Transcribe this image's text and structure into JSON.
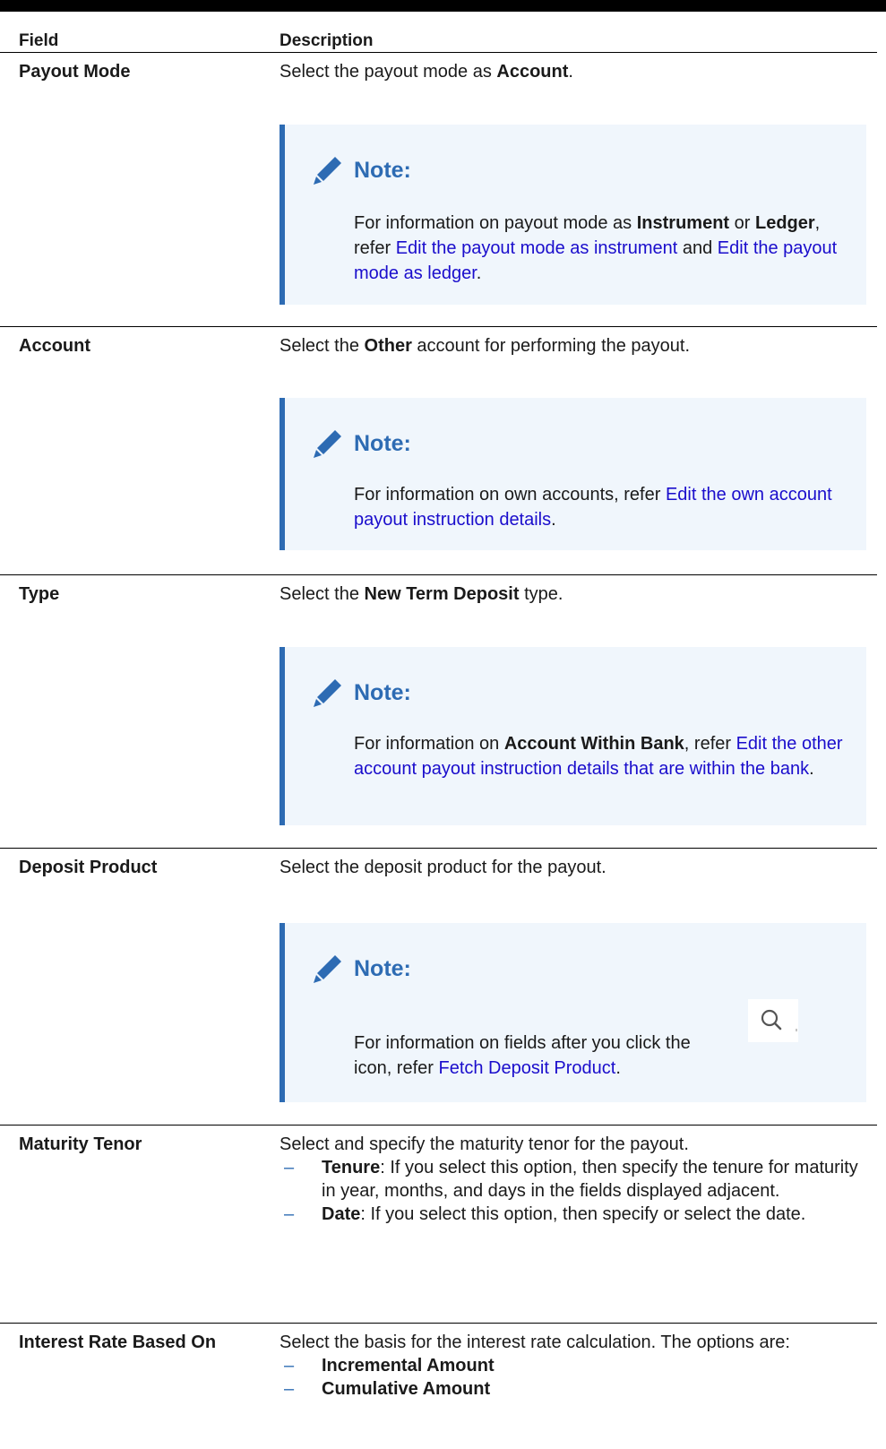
{
  "header": {
    "field": "Field",
    "description": "Description"
  },
  "rows": [
    {
      "field": "Payout Mode",
      "desc": {
        "pre": "Select the payout mode as ",
        "bold": "Account",
        "post": "."
      },
      "note": {
        "title": "Note:",
        "pre": "For information on payout mode as ",
        "b1": "Instrument",
        "mid1": " or ",
        "b2": "Ledger",
        "mid2": ", refer ",
        "link1": "Edit the payout mode as instrument",
        "mid3": " and ",
        "link2": "Edit the payout mode as ledger",
        "post": "."
      }
    },
    {
      "field": "Account",
      "desc": {
        "pre": "Select the ",
        "bold": "Other",
        "post": " account for performing the payout."
      },
      "note": {
        "title": "Note:",
        "pre": "For information on own accounts, refer ",
        "link": "Edit the own account payout instruction details",
        "post": "."
      }
    },
    {
      "field": "Type",
      "desc": {
        "pre": "Select the ",
        "bold": "New Term Deposit",
        "post": " type."
      },
      "note": {
        "title": "Note:",
        "pre": "For information on ",
        "bold": "Account Within Bank",
        "mid": ", refer ",
        "link": "Edit the other account payout instruction details that are within the bank",
        "post": "."
      }
    },
    {
      "field": "Deposit Product",
      "desc": {
        "text": "Select the deposit product for the payout."
      },
      "note": {
        "title": "Note:",
        "pre": "For information on fields after you click the",
        "mid": "icon, refer ",
        "link": "Fetch Deposit Product",
        "post": "."
      }
    },
    {
      "field": "Maturity Tenor",
      "desc": {
        "text": "Select and specify the maturity tenor for the payout."
      },
      "items": [
        {
          "bold": "Tenure",
          "text": ": If you select this option, then specify the tenure for maturity in year, months, and days in the fields displayed adjacent."
        },
        {
          "bold": "Date",
          "text": ": If you select this option, then specify or select the date."
        }
      ]
    },
    {
      "field": "Interest Rate Based On",
      "desc": {
        "text": "Select the basis for the interest rate calculation. The options are:"
      },
      "items": [
        {
          "bold": "Incremental Amount"
        },
        {
          "bold": "Cumulative Amount"
        }
      ]
    }
  ],
  "colors": {
    "link": "#1a0dcc",
    "note_accent": "#2d6bb3",
    "note_bg": "#f0f6fc"
  }
}
